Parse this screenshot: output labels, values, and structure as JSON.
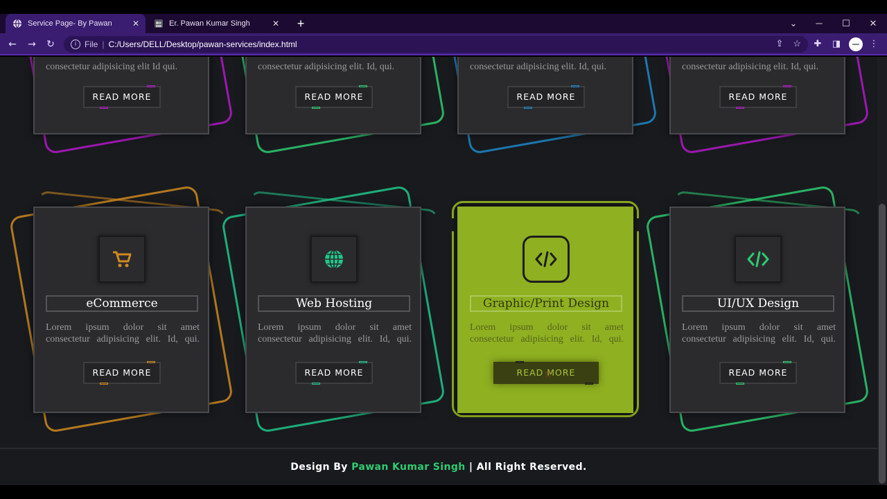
{
  "browser": {
    "tabs": [
      {
        "title": "Service Page- By Pawan",
        "active": true
      },
      {
        "title": "Er. Pawan Kumar Singh",
        "active": false
      }
    ],
    "address": {
      "scheme_label": "File",
      "url": "C:/Users/DELL/Desktop/pawan-services/index.html"
    },
    "window_controls": {
      "minimize": "─",
      "maximize": "☐",
      "close": "✕"
    }
  },
  "colors": {
    "purple": "#b419c9",
    "green": "#2ecc71",
    "blue": "#1e88c8",
    "orange": "#d08a1e",
    "teal": "#22c78a",
    "lime": "#8fb021"
  },
  "top_row": [
    {
      "desc_tail": "consectetur adipisicing elit Id qui.",
      "button": "READ MORE",
      "accent": "#b419c9"
    },
    {
      "desc_tail": "consectetur adipisicing elit. Id, qui.",
      "button": "READ MORE",
      "accent": "#2ecc71"
    },
    {
      "desc_tail": "consectetur adipisicing elit. Id, qui.",
      "button": "READ MORE",
      "accent": "#1e88c8"
    },
    {
      "desc_tail": "consectetur adipisicing elit. Id, qui.",
      "button": "READ MORE",
      "accent": "#b419c9"
    }
  ],
  "services": [
    {
      "title": "eCommerce",
      "icon": "shopping-cart-icon",
      "desc": "Lorem ipsum dolor sit amet consectetur adipisicing elit. Id, qui.",
      "button": "READ MORE",
      "accent": "#d08a1e"
    },
    {
      "title": "Web Hosting",
      "icon": "globe-icon",
      "desc": "Lorem ipsum dolor sit amet consectetur adipisicing elit. Id, qui.",
      "button": "READ MORE",
      "accent": "#22c78a"
    },
    {
      "title": "Graphic/Print Design",
      "icon": "code-icon",
      "desc": "Lorem ipsum dolor sit amet consectetur adipisicing elit. Id, qui.",
      "button": "READ MORE",
      "accent": "#8fb021",
      "hovered": true
    },
    {
      "title": "UI/UX Design",
      "icon": "code-icon",
      "desc": "Lorem ipsum dolor sit amet consectetur adipisicing elit. Id, qui.",
      "button": "READ MORE",
      "accent": "#2ecc71"
    }
  ],
  "footer": {
    "prefix": "Design By ",
    "author": "Pawan Kumar Singh",
    "suffix": " | All Right Reserved."
  }
}
